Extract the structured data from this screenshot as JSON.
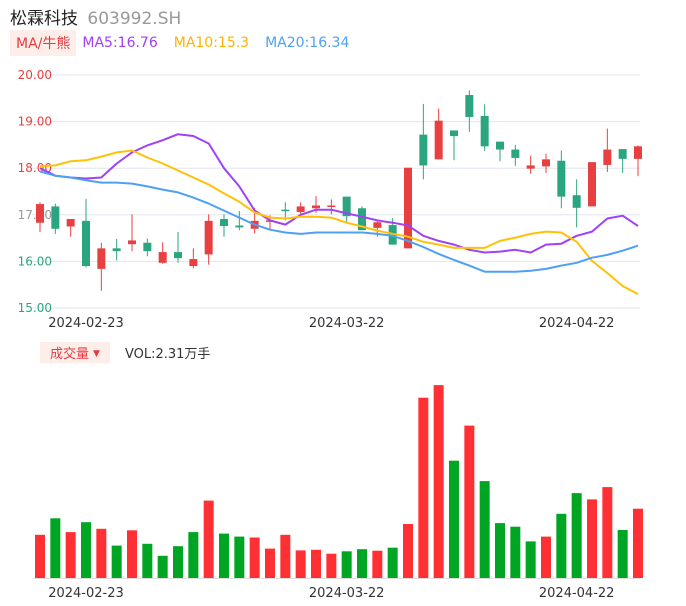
{
  "header": {
    "name": "松霖科技",
    "code": "603992.SH"
  },
  "legend": {
    "mode": "MA/牛熊",
    "ma5": "MA5:16.76",
    "ma10": "MA10:15.3",
    "ma20": "MA20:16.34"
  },
  "volume_legend": {
    "label": "成交量",
    "vol": "VOL:2.31万手"
  },
  "colors": {
    "up": "#e84040",
    "down": "#2aa57f",
    "vol_up": "#ff3034",
    "vol_down": "#00a524",
    "ma5": "#a041f5",
    "ma10": "#ffc107",
    "ma20": "#4ea0f5"
  },
  "chart_data": [
    {
      "type": "candlestick",
      "ylim": [
        15,
        20
      ],
      "yticks": [
        "20.00",
        "19.00",
        "18.00",
        "17.00",
        "16.00",
        "15.00"
      ],
      "ytick_values": [
        20,
        19,
        18,
        17,
        16,
        15
      ],
      "xtick_labels": [
        {
          "index": 3,
          "label": "2024-02-23"
        },
        {
          "index": 20,
          "label": "2024-03-22"
        },
        {
          "index": 35,
          "label": "2024-04-22"
        }
      ],
      "ohlc": [
        [
          16.83,
          17.27,
          16.63,
          17.23
        ],
        [
          17.18,
          17.24,
          16.59,
          16.7
        ],
        [
          16.75,
          16.91,
          16.53,
          16.91
        ],
        [
          16.87,
          17.34,
          15.87,
          15.9
        ],
        [
          15.84,
          16.4,
          15.37,
          16.28
        ],
        [
          16.28,
          16.48,
          16.02,
          16.22
        ],
        [
          16.37,
          17.01,
          16.22,
          16.45
        ],
        [
          16.4,
          16.49,
          16.11,
          16.22
        ],
        [
          15.97,
          16.41,
          15.95,
          16.2
        ],
        [
          16.2,
          16.63,
          15.97,
          16.07
        ],
        [
          15.9,
          16.28,
          15.85,
          16.05
        ],
        [
          16.15,
          17.01,
          15.93,
          16.87
        ],
        [
          16.91,
          17.01,
          16.53,
          16.76
        ],
        [
          16.77,
          17.08,
          16.67,
          16.73
        ],
        [
          16.7,
          17.15,
          16.6,
          16.87
        ],
        [
          16.86,
          16.99,
          16.68,
          16.88
        ],
        [
          17.11,
          17.27,
          16.88,
          17.08
        ],
        [
          17.06,
          17.27,
          17.01,
          17.18
        ],
        [
          17.14,
          17.4,
          17.04,
          17.2
        ],
        [
          17.17,
          17.33,
          17.01,
          17.2
        ],
        [
          17.39,
          17.39,
          16.84,
          16.97
        ],
        [
          17.14,
          17.18,
          16.67,
          16.67
        ],
        [
          16.72,
          16.9,
          16.53,
          16.84
        ],
        [
          16.78,
          16.93,
          16.36,
          16.36
        ],
        [
          16.28,
          18.01,
          16.28,
          18.01
        ],
        [
          18.72,
          19.38,
          17.76,
          18.06
        ],
        [
          18.19,
          19.28,
          18.19,
          19.02
        ],
        [
          18.81,
          18.81,
          18.17,
          18.69
        ],
        [
          19.57,
          19.67,
          18.78,
          19.1
        ],
        [
          19.12,
          19.37,
          18.37,
          18.47
        ],
        [
          18.57,
          18.57,
          18.15,
          18.4
        ],
        [
          18.4,
          18.5,
          18.05,
          18.22
        ],
        [
          17.99,
          18.27,
          17.88,
          18.06
        ],
        [
          18.04,
          18.31,
          17.9,
          18.19
        ],
        [
          18.16,
          18.38,
          17.14,
          17.39
        ],
        [
          17.42,
          17.76,
          16.73,
          17.15
        ],
        [
          17.18,
          18.13,
          17.18,
          18.13
        ],
        [
          18.07,
          18.85,
          17.92,
          18.4
        ],
        [
          18.41,
          18.41,
          17.9,
          18.2
        ],
        [
          18.2,
          18.49,
          17.83,
          18.47
        ]
      ],
      "series": [
        {
          "name": "MA5",
          "values": [
            18.0,
            17.84,
            17.8,
            17.78,
            17.8,
            18.1,
            18.34,
            18.49,
            18.6,
            18.73,
            18.69,
            18.53,
            18.0,
            17.61,
            17.09,
            16.88,
            16.79,
            17.0,
            17.11,
            17.11,
            17.03,
            16.96,
            16.88,
            16.83,
            16.77,
            16.55,
            16.44,
            16.36,
            16.25,
            16.19,
            16.21,
            16.25,
            16.19,
            16.36,
            16.38,
            16.55,
            16.64,
            16.92,
            16.98,
            16.76
          ]
        },
        {
          "name": "MA10",
          "values": [
            18.04,
            18.06,
            18.15,
            18.17,
            18.25,
            18.34,
            18.38,
            18.23,
            18.1,
            17.95,
            17.8,
            17.65,
            17.46,
            17.28,
            17.05,
            16.94,
            16.92,
            16.96,
            16.96,
            16.94,
            16.83,
            16.75,
            16.66,
            16.59,
            16.53,
            16.42,
            16.36,
            16.29,
            16.29,
            16.29,
            16.44,
            16.51,
            16.59,
            16.64,
            16.62,
            16.42,
            16.01,
            15.75,
            15.47,
            15.3
          ]
        },
        {
          "name": "MA20",
          "values": [
            17.93,
            17.84,
            17.8,
            17.74,
            17.69,
            17.69,
            17.67,
            17.61,
            17.54,
            17.48,
            17.37,
            17.24,
            17.09,
            16.94,
            16.79,
            16.68,
            16.62,
            16.59,
            16.62,
            16.62,
            16.62,
            16.62,
            16.59,
            16.55,
            16.44,
            16.31,
            16.16,
            16.03,
            15.91,
            15.78,
            15.78,
            15.78,
            15.8,
            15.84,
            15.91,
            15.97,
            16.08,
            16.14,
            16.23,
            16.34
          ]
        }
      ]
    },
    {
      "type": "bar",
      "unit": "万手",
      "values": [
        1.44,
        1.99,
        1.53,
        1.86,
        1.64,
        1.08,
        1.59,
        1.14,
        0.74,
        1.06,
        1.53,
        2.58,
        1.48,
        1.38,
        1.35,
        0.98,
        1.44,
        0.92,
        0.94,
        0.81,
        0.89,
        0.96,
        0.91,
        1.01,
        1.8,
        6.01,
        6.43,
        3.91,
        5.08,
        3.23,
        1.83,
        1.71,
        1.22,
        1.38,
        2.14,
        2.83,
        2.62,
        3.03,
        1.6,
        2.31
      ],
      "directions": [
        "u",
        "d",
        "u",
        "d",
        "u",
        "d",
        "u",
        "d",
        "d",
        "d",
        "d",
        "u",
        "d",
        "d",
        "u",
        "u",
        "u",
        "u",
        "u",
        "u",
        "d",
        "d",
        "u",
        "d",
        "u",
        "u",
        "u",
        "d",
        "u",
        "d",
        "d",
        "d",
        "d",
        "u",
        "d",
        "d",
        "u",
        "u",
        "d",
        "u"
      ],
      "xtick_labels": [
        {
          "index": 3,
          "label": "2024-02-23"
        },
        {
          "index": 20,
          "label": "2024-03-22"
        },
        {
          "index": 35,
          "label": "2024-04-22"
        }
      ]
    }
  ]
}
